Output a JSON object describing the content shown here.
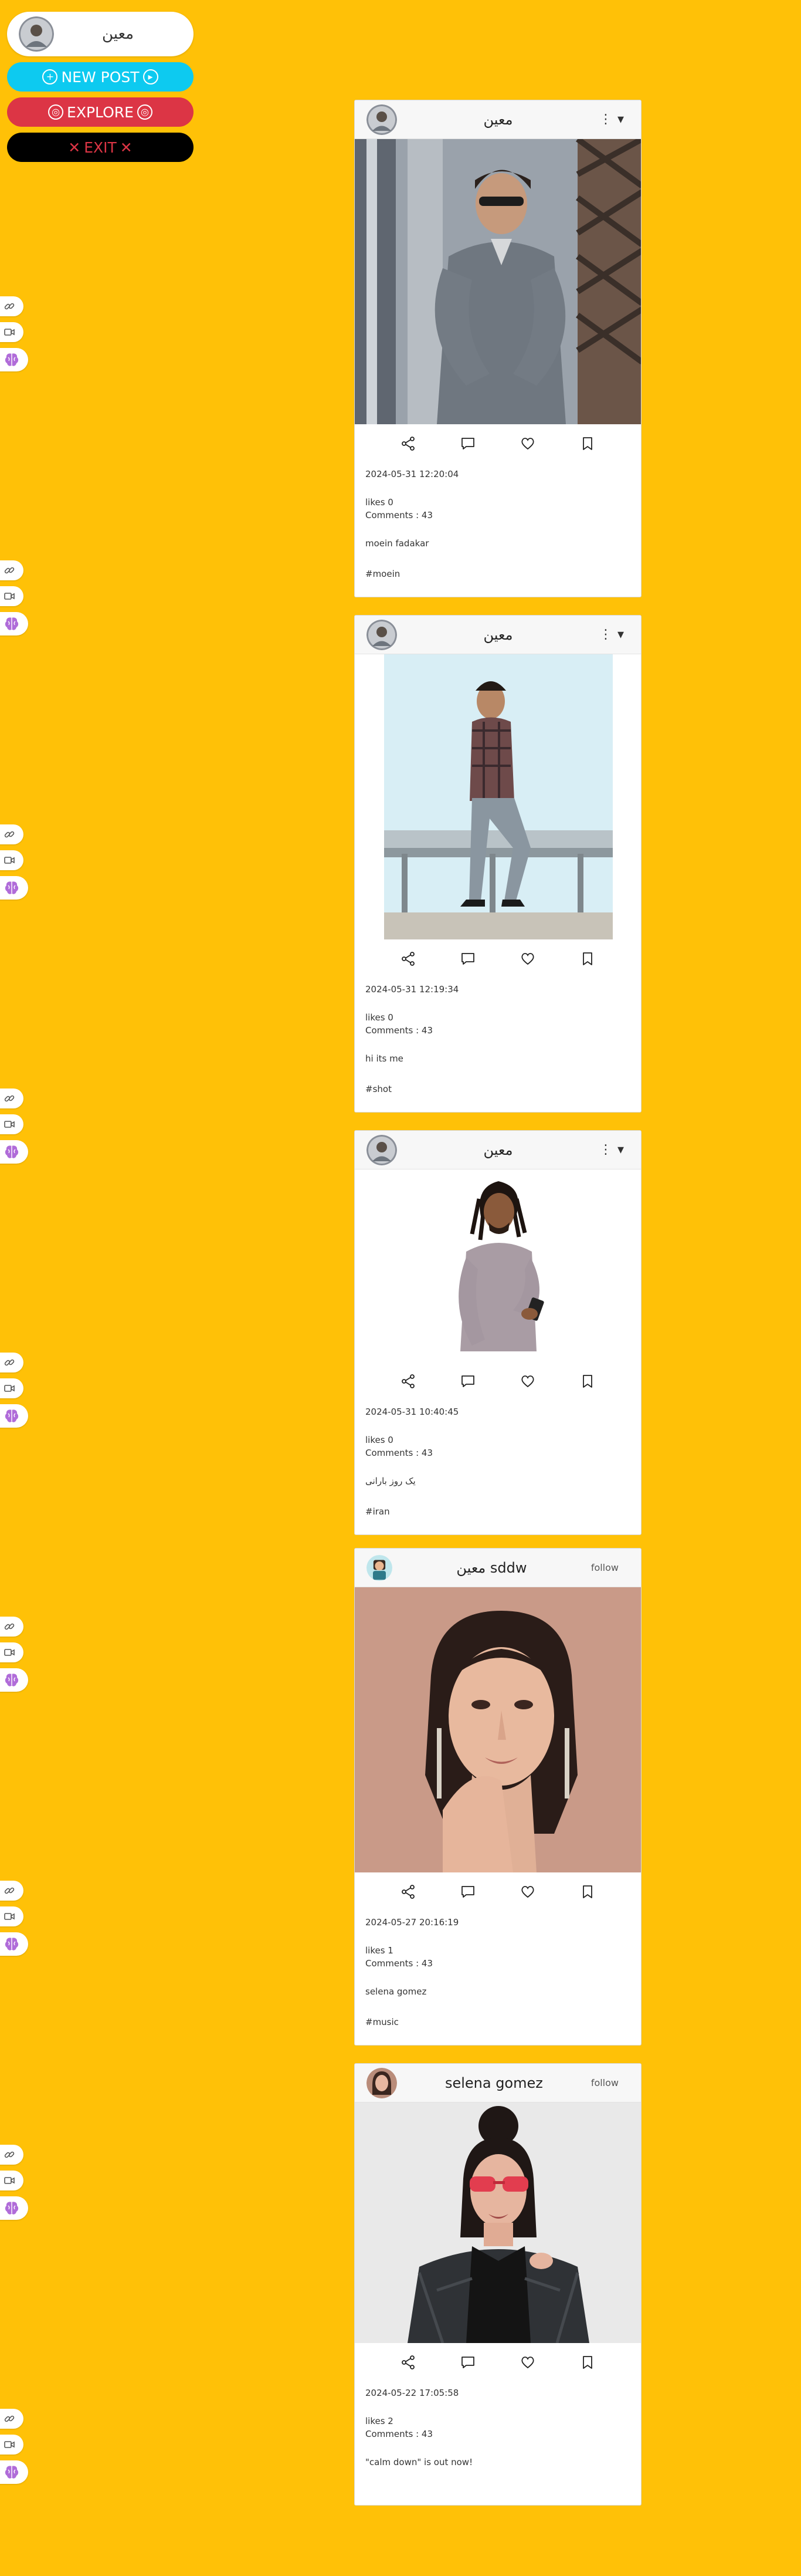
{
  "menu": {
    "username": "معین",
    "new_post": "NEW POST",
    "explore": "EXPLORE",
    "exit": "EXIT"
  },
  "colors": {
    "background": "#ffc107",
    "new_post": "#0dcaf0",
    "explore": "#dc3545",
    "exit_bg": "#000000",
    "exit_text": "#dc3545"
  },
  "side_icons": [
    "link-icon",
    "video-icon",
    "brain-icon"
  ],
  "posts": [
    {
      "name": "معین",
      "right_control": "more",
      "date": "2024-05-31 12:20:04",
      "likes": "likes 0",
      "comments": "Comments : 43",
      "caption": "moein fadakar",
      "tag": "#moein"
    },
    {
      "name": "معین",
      "right_control": "more",
      "date": "2024-05-31 12:19:34",
      "likes": "likes 0",
      "comments": "Comments : 43",
      "caption": "hi its me",
      "tag": "#shot"
    },
    {
      "name": "معین",
      "right_control": "more",
      "date": "2024-05-31 10:40:45",
      "likes": "likes 0",
      "comments": "Comments : 43",
      "caption": "یک روز بارانی",
      "tag": "#iran"
    },
    {
      "name": "معین sddw",
      "right_control": "follow",
      "follow": "follow",
      "date": "2024-05-27 20:16:19",
      "likes": "likes 1",
      "comments": "Comments : 43",
      "caption": "selena gomez",
      "tag": "#music"
    },
    {
      "name": "selena gomez",
      "right_control": "follow",
      "follow": "follow",
      "date": "2024-05-22 17:05:58",
      "likes": "likes 2",
      "comments": "Comments : 43",
      "caption": "\"calm down\" is out now!",
      "tag": ""
    }
  ]
}
